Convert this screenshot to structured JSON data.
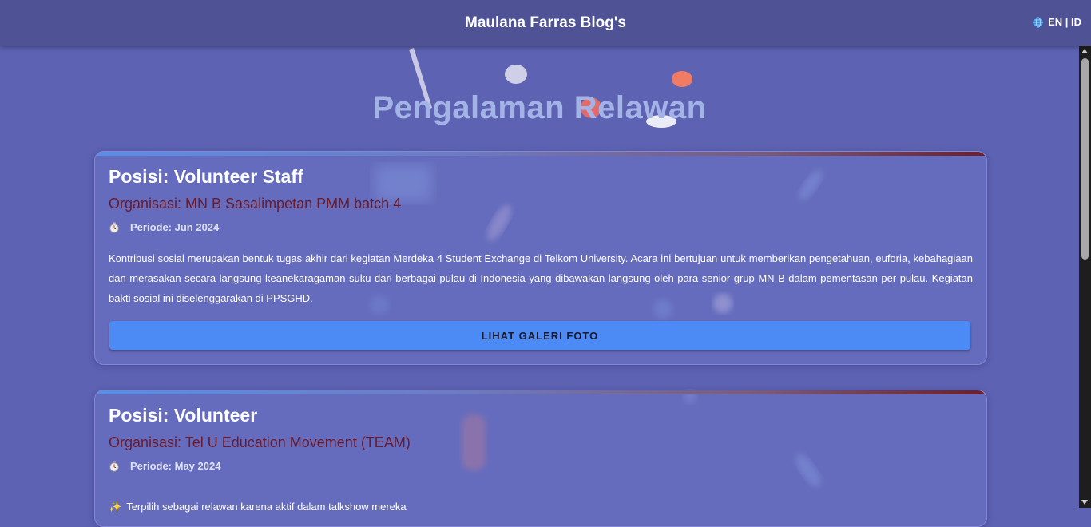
{
  "header": {
    "title": "Maulana Farras Blog's",
    "lang_label": "EN | ID"
  },
  "page": {
    "title": "Pengalaman Relawan"
  },
  "experiences": [
    {
      "position": "Posisi: Volunteer Staff",
      "organization": "Organisasi: MN B Sasalimpetan PMM batch 4",
      "period": "Periode: Jun 2024",
      "description": "Kontribusi sosial merupakan bentuk tugas akhir dari kegiatan Merdeka 4 Student Exchange di Telkom University. Acara ini bertujuan untuk memberikan pengetahuan, euforia, kebahagiaan dan merasakan secara langsung keanekaragaman suku dari berbagai pulau di Indonesia yang dibawakan langsung oleh para senior grup MN B dalam pementasan per pulau. Kegiatan bakti sosial ini diselenggarakan di PPSGHD.",
      "button_label": "LIHAT GALERI FOTO"
    },
    {
      "position": "Posisi: Volunteer",
      "organization": "Organisasi: Tel U Education Movement (TEAM)",
      "period": "Periode: May 2024",
      "highlight": "Terpilih sebagai relawan karena aktif dalam talkshow mereka"
    }
  ],
  "colors": {
    "background": "#5d62b3",
    "header": "#4f5396",
    "organization_text": "#6b1b2c",
    "button": "#4c8bf5",
    "title": "#a3b3e6"
  },
  "icons": {
    "language": "globe-icon",
    "period": "stopwatch-icon",
    "highlight": "sparkle-icon"
  }
}
